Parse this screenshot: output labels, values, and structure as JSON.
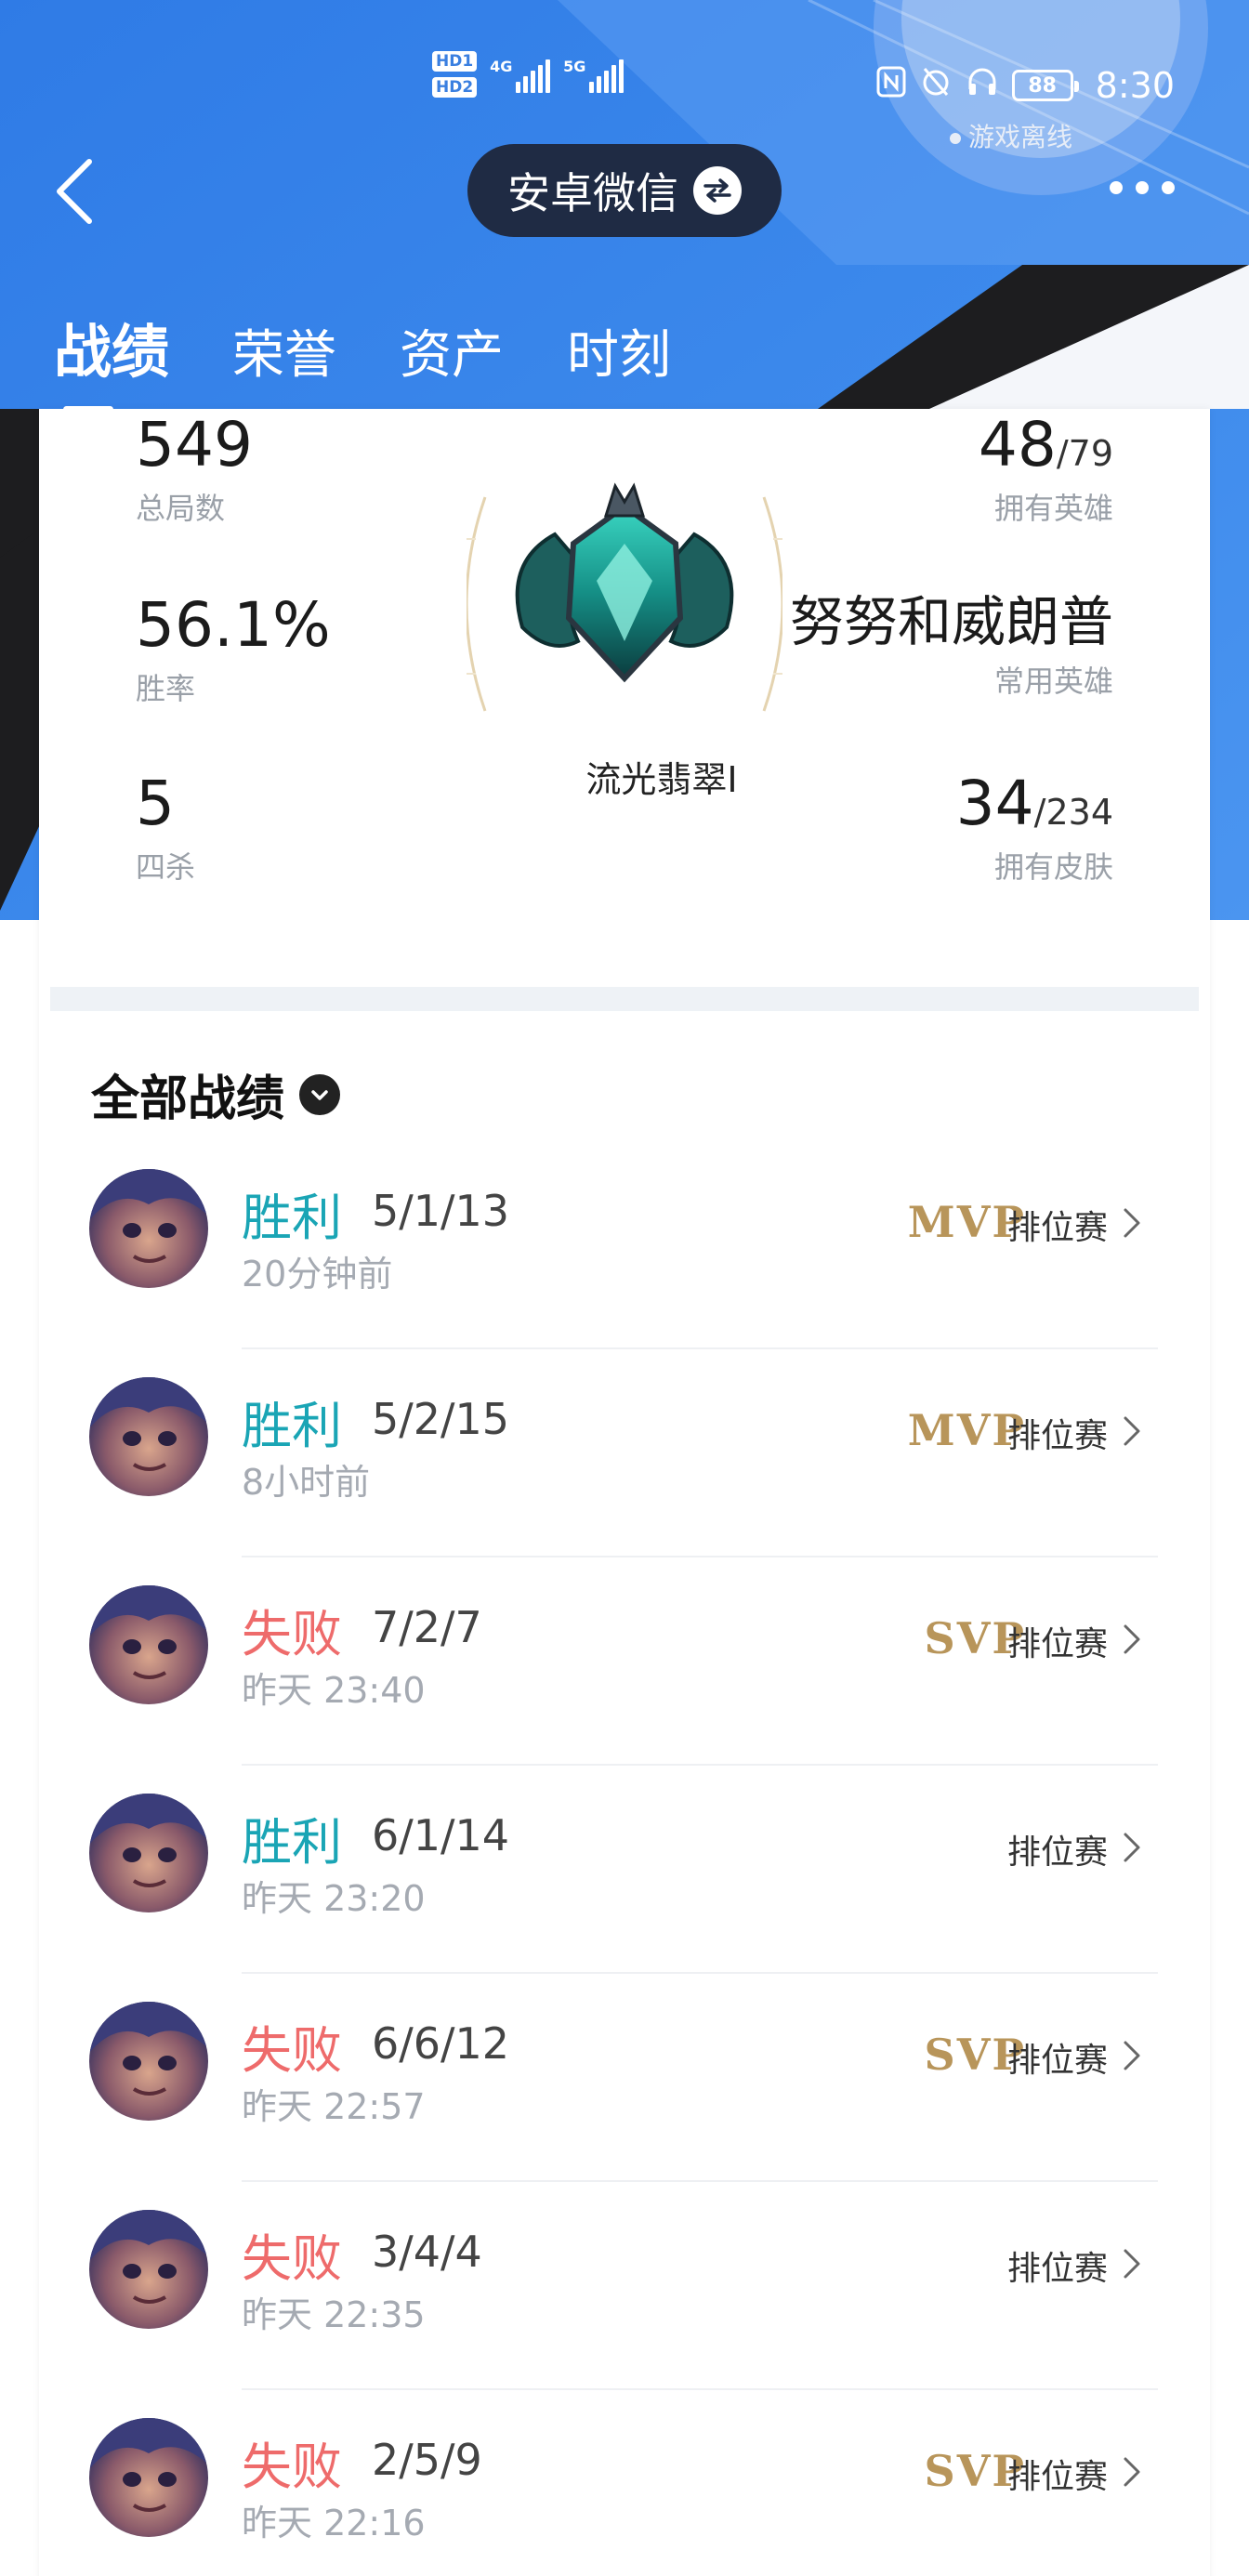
{
  "status_bar": {
    "hd_badges": [
      "HD1",
      "HD2"
    ],
    "network_1": "4G",
    "network_2": "5G",
    "battery": "88",
    "time": "8:30"
  },
  "header": {
    "back_icon": "chevron-left-icon",
    "account_name": "安卓微信",
    "switch_icon": "swap-arrows-icon",
    "more_icon": "more-dots-icon",
    "online_status": "游戏离线"
  },
  "tabs": [
    {
      "label": "战绩",
      "active": true
    },
    {
      "label": "荣誉",
      "active": false
    },
    {
      "label": "资产",
      "active": false
    },
    {
      "label": "时刻",
      "active": false
    }
  ],
  "summary": {
    "total_games": {
      "value": "549",
      "label": "总局数"
    },
    "win_rate": {
      "value": "56.1%",
      "label": "胜率"
    },
    "quadra_kills": {
      "value": "5",
      "label": "四杀"
    },
    "heroes_owned": {
      "value": "48",
      "total": "/79",
      "label": "拥有英雄"
    },
    "common_hero": {
      "value": "努努和威朗普",
      "label": "常用英雄"
    },
    "skins_owned": {
      "value": "34",
      "total": "/234",
      "label": "拥有皮肤"
    },
    "rank": "流光翡翠I"
  },
  "matches_section": {
    "title": "全部战绩",
    "matches": [
      {
        "result": "胜利",
        "type": "win",
        "kda": "5/1/13",
        "time": "20分钟前",
        "badge": "MVP",
        "mode": "排位赛"
      },
      {
        "result": "胜利",
        "type": "win",
        "kda": "5/2/15",
        "time": "8小时前",
        "badge": "MVP",
        "mode": "排位赛"
      },
      {
        "result": "失败",
        "type": "loss",
        "kda": "7/2/7",
        "time": "昨天 23:40",
        "badge": "SVP",
        "mode": "排位赛"
      },
      {
        "result": "胜利",
        "type": "win",
        "kda": "6/1/14",
        "time": "昨天 23:20",
        "badge": "",
        "mode": "排位赛"
      },
      {
        "result": "失败",
        "type": "loss",
        "kda": "6/6/12",
        "time": "昨天 22:57",
        "badge": "SVP",
        "mode": "排位赛"
      },
      {
        "result": "失败",
        "type": "loss",
        "kda": "3/4/4",
        "time": "昨天 22:35",
        "badge": "",
        "mode": "排位赛"
      },
      {
        "result": "失败",
        "type": "loss",
        "kda": "2/5/9",
        "time": "昨天 22:16",
        "badge": "SVP",
        "mode": "排位赛"
      }
    ]
  },
  "colors": {
    "header_blue": "#3a86e8",
    "dark_band": "#1c1c1c",
    "win": "#1aa5b5",
    "loss": "#ee6b6b",
    "badge_gold": "#b8955a"
  }
}
